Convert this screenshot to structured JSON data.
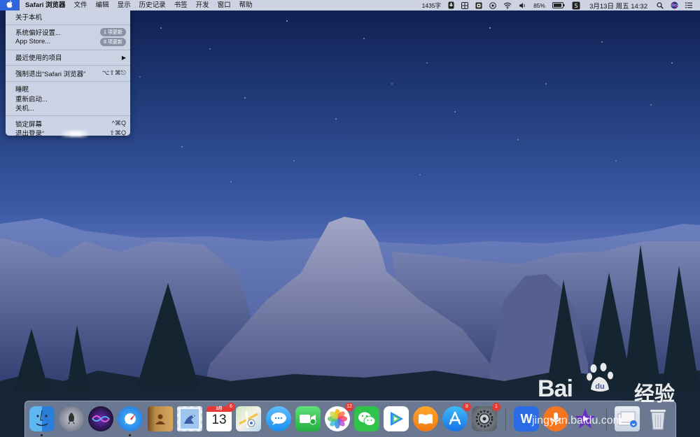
{
  "menubar": {
    "app_name": "Safari 浏览器",
    "items": [
      "文件",
      "编辑",
      "显示",
      "历史记录",
      "书签",
      "开发",
      "窗口",
      "帮助"
    ],
    "word_count": "1435字",
    "battery": "85%",
    "datetime": "3月13日 周五  14:32"
  },
  "apple_menu": {
    "about": "关于本机",
    "system_prefs": "系统偏好设置...",
    "system_prefs_badge": "1 项更新",
    "app_store": "App Store...",
    "app_store_badge": "8 项更新",
    "recent_items": "最近使用的项目",
    "force_quit": "强制退出“Safari 浏览器”",
    "force_quit_shortcut": "⌥⇧⌘⎋",
    "sleep": "睡眠",
    "restart": "重新启动...",
    "shutdown": "关机...",
    "lock_screen": "锁定屏幕",
    "lock_screen_shortcut": "^⌘Q",
    "logout": "退出登录“",
    "logout_shortcut": "⇧⌘Q"
  },
  "dock": {
    "calendar_month": "3月",
    "calendar_day": "13",
    "calendar_badge": "6",
    "photos_badge": "12",
    "appstore_badge": "8",
    "sysprefs_badge": "1",
    "wps_label": "W"
  },
  "watermark": {
    "brand": "Bai",
    "brand2": "经验",
    "url": "jingyan.baidu.com"
  }
}
